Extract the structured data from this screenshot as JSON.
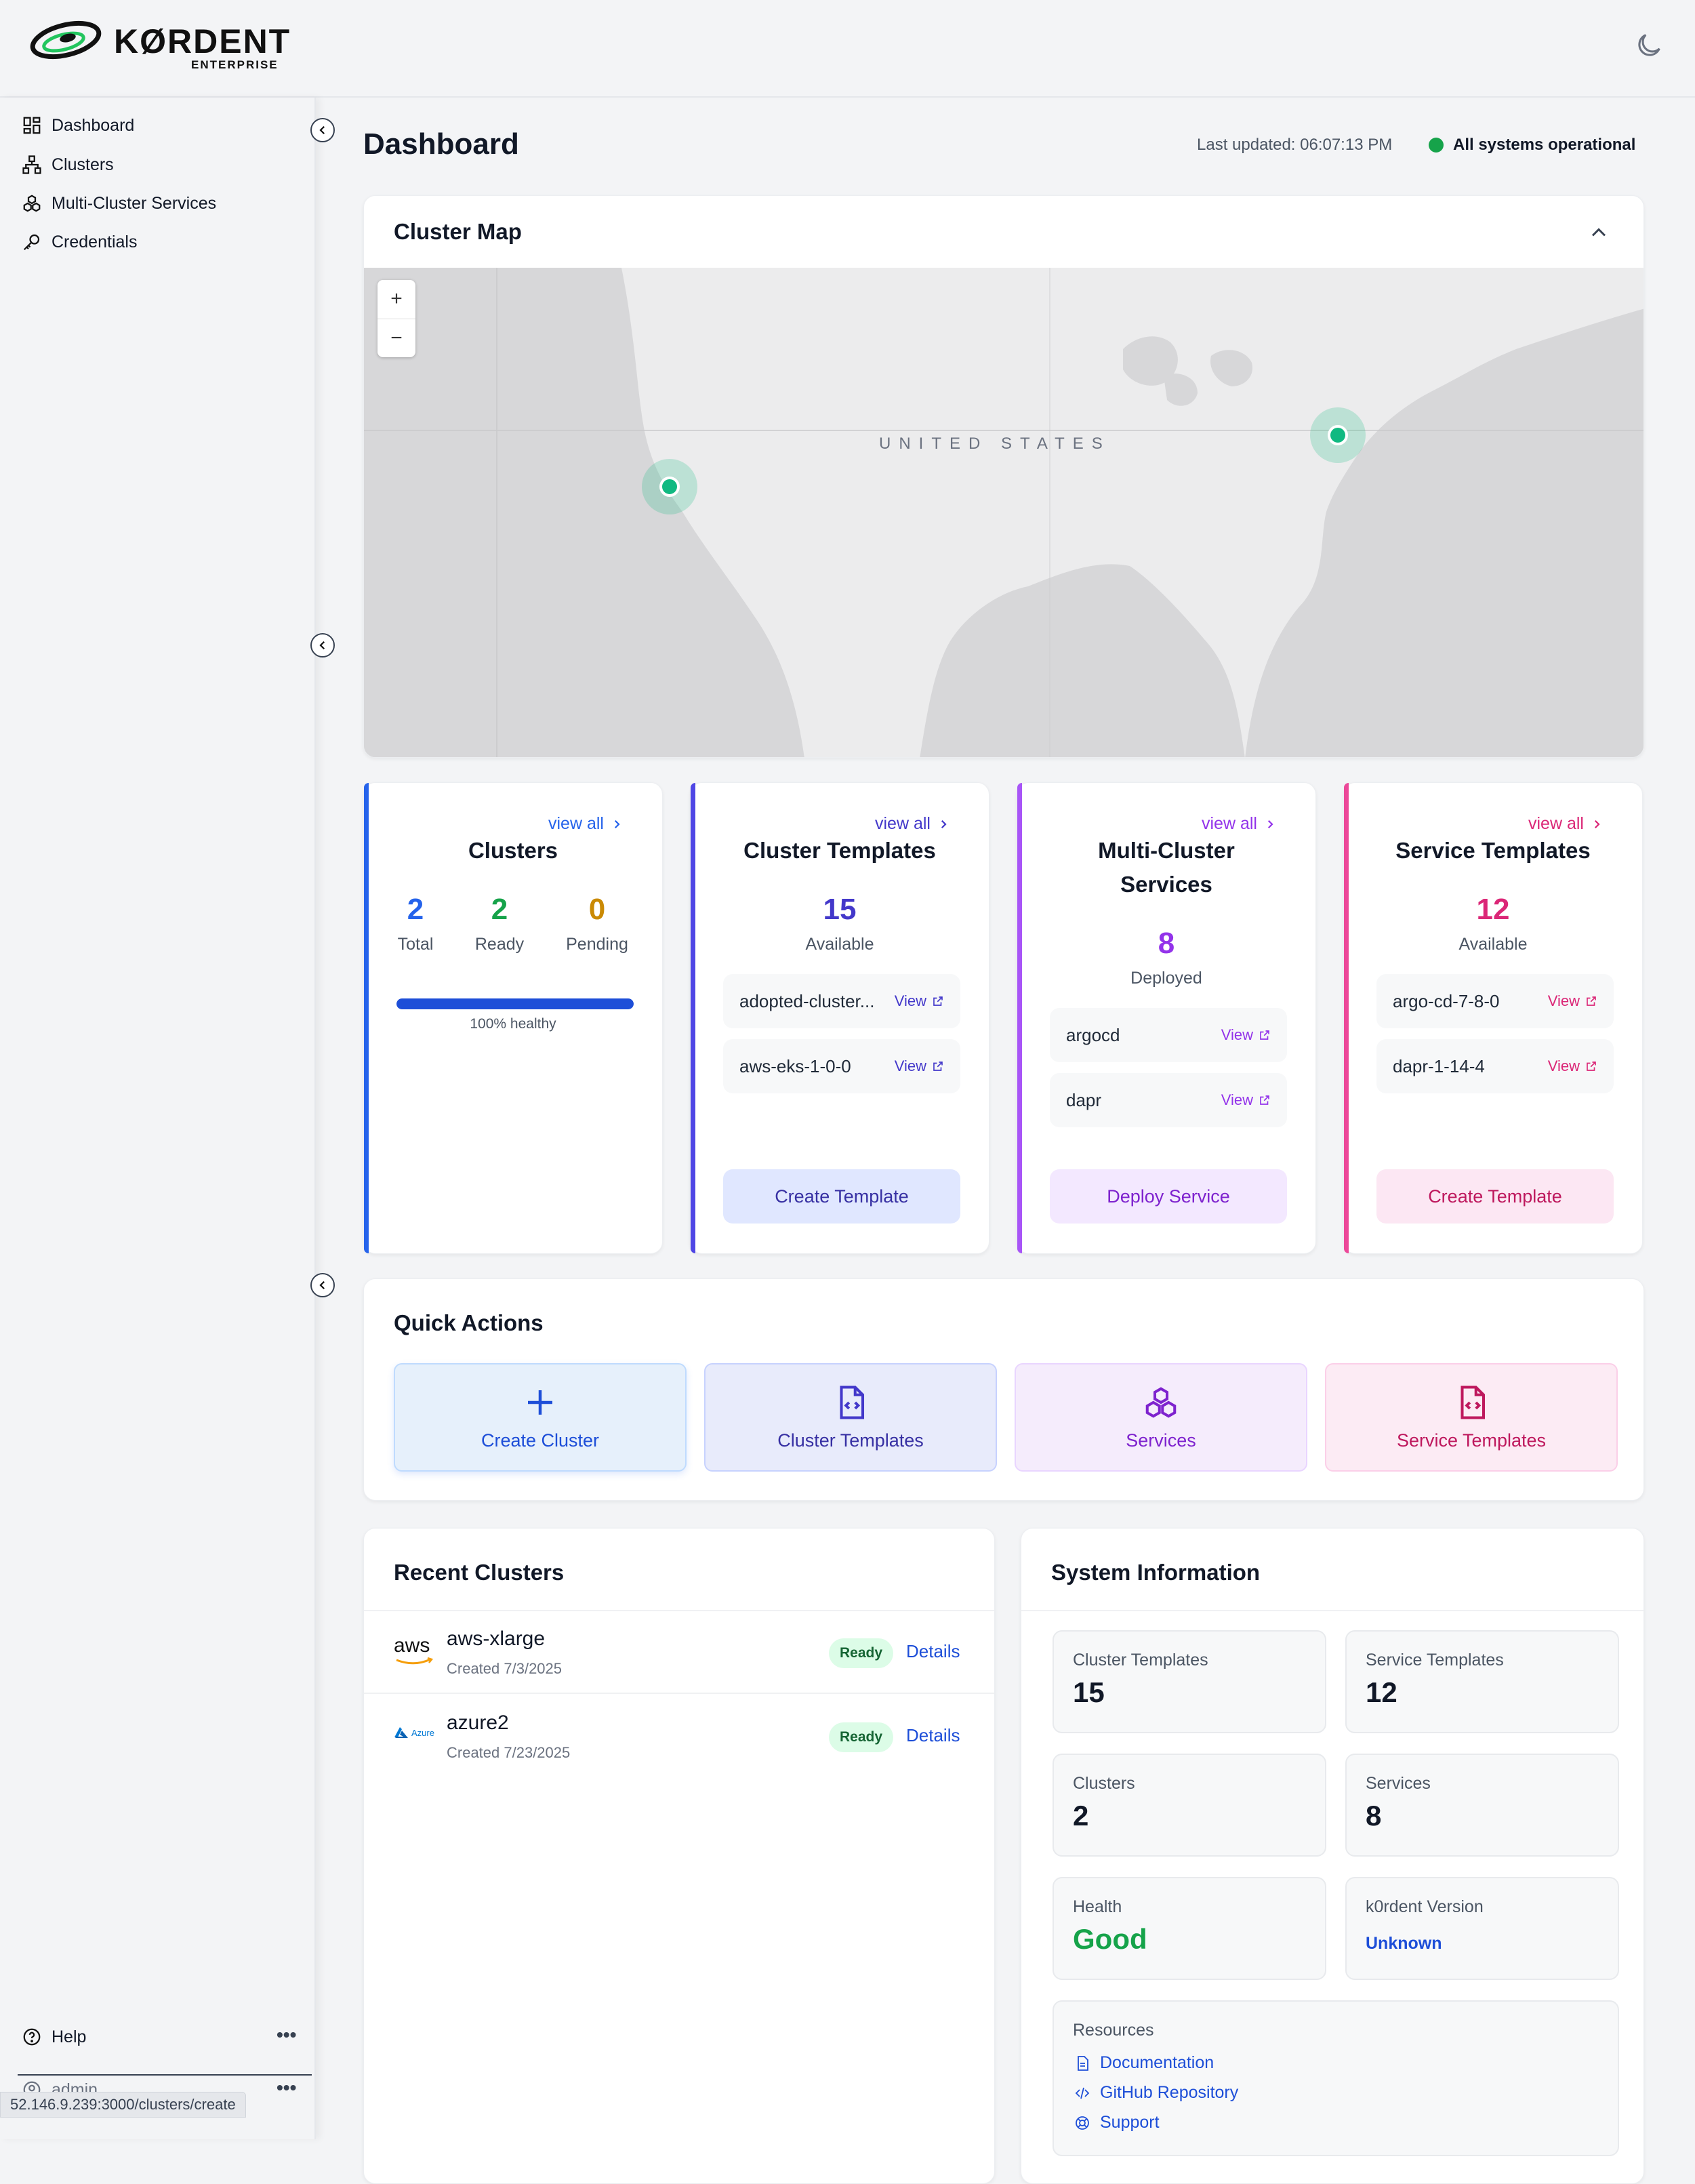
{
  "app": {
    "logo_text": "KØRDENT",
    "logo_sub": "ENTERPRISE"
  },
  "sidebar": {
    "items": [
      {
        "label": "Dashboard",
        "icon": "dashboard-icon"
      },
      {
        "label": "Clusters",
        "icon": "clusters-icon"
      },
      {
        "label": "Multi-Cluster Services",
        "icon": "services-icon"
      },
      {
        "label": "Credentials",
        "icon": "key-icon"
      }
    ],
    "help_label": "Help",
    "user_label": "admin",
    "more_glyph": "•••",
    "status_url": "52.146.9.239:3000/clusters/create"
  },
  "header": {
    "title": "Dashboard",
    "last_updated": "Last updated: 06:07:13 PM",
    "status_text": "All systems operational",
    "status_color": "#16a34a"
  },
  "map": {
    "title": "Cluster Map",
    "zoom_in": "+",
    "zoom_out": "−",
    "country_label": "UNITED STATES"
  },
  "stats": {
    "clusters": {
      "view_all": "view all",
      "title": "Clusters",
      "total": "2",
      "total_label": "Total",
      "ready": "2",
      "ready_label": "Ready",
      "pending": "0",
      "pending_label": "Pending",
      "health_fraction": 1.0,
      "health_text": "100% healthy",
      "accent": "#2563eb"
    },
    "cluster_templates": {
      "view_all": "view all",
      "title": "Cluster Templates",
      "count": "15",
      "count_label": "Available",
      "items": [
        {
          "name": "adopted-cluster...",
          "action": "View"
        },
        {
          "name": "aws-eks-1-0-0",
          "action": "View"
        }
      ],
      "button": "Create Template",
      "accent": "#4338ca"
    },
    "multi_cluster": {
      "view_all": "view all",
      "title_line1": "Multi-Cluster",
      "title_line2": "Services",
      "count": "8",
      "count_label": "Deployed",
      "items": [
        {
          "name": "argocd",
          "action": "View"
        },
        {
          "name": "dapr",
          "action": "View"
        }
      ],
      "button": "Deploy Service",
      "accent": "#9333ea"
    },
    "service_templates": {
      "view_all": "view all",
      "title": "Service Templates",
      "count": "12",
      "count_label": "Available",
      "items": [
        {
          "name": "argo-cd-7-8-0",
          "action": "View"
        },
        {
          "name": "dapr-1-14-4",
          "action": "View"
        }
      ],
      "button": "Create Template",
      "accent": "#db2777"
    }
  },
  "quick_actions": {
    "title": "Quick Actions",
    "buttons": [
      {
        "label": "Create Cluster",
        "icon": "plus-icon"
      },
      {
        "label": "Cluster Templates",
        "icon": "file-code-icon"
      },
      {
        "label": "Services",
        "icon": "boxes-icon"
      },
      {
        "label": "Service Templates",
        "icon": "file-code-icon"
      }
    ]
  },
  "recent_clusters": {
    "title": "Recent Clusters",
    "rows": [
      {
        "logo": "aws",
        "name": "aws-xlarge",
        "created": "Created 7/3/2025",
        "status": "Ready",
        "action": "Details"
      },
      {
        "logo": "Azure",
        "name": "azure2",
        "created": "Created 7/23/2025",
        "status": "Ready",
        "action": "Details"
      }
    ]
  },
  "system_info": {
    "title": "System Information",
    "cluster_templates_label": "Cluster Templates",
    "cluster_templates_value": "15",
    "service_templates_label": "Service Templates",
    "service_templates_value": "12",
    "clusters_label": "Clusters",
    "clusters_value": "2",
    "services_label": "Services",
    "services_value": "8",
    "health_label": "Health",
    "health_value": "Good",
    "version_label": "k0rdent Version",
    "version_value": "Unknown",
    "resources_label": "Resources",
    "links": [
      "Documentation",
      "GitHub Repository",
      "Support"
    ]
  }
}
